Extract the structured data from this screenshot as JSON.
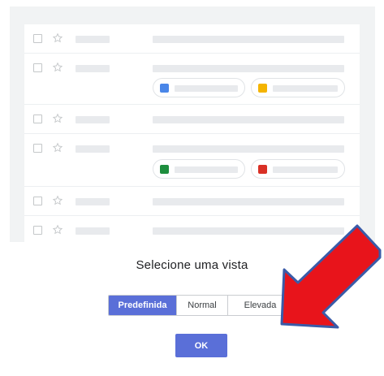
{
  "dialog": {
    "title": "Selecione uma vista",
    "view_options": [
      "Predefinida",
      "Normal",
      "Elevada"
    ],
    "selected_view": "Predefinida",
    "ok_label": "OK"
  },
  "preview": {
    "rows": [
      {
        "type": "plain"
      },
      {
        "type": "attachments",
        "attachments": [
          "docs-icon",
          "slides-icon"
        ]
      },
      {
        "type": "plain"
      },
      {
        "type": "attachments",
        "attachments": [
          "sheets-icon",
          "image-icon"
        ]
      },
      {
        "type": "plain"
      },
      {
        "type": "plain"
      }
    ]
  },
  "colors": {
    "accent": "#5a6fd8",
    "arrow_fill": "#e8141b",
    "arrow_outline": "#3a5ba8",
    "docs": "#4a86e8",
    "slides": "#f4b400",
    "sheets": "#1e8e3e",
    "image": "#d93025"
  }
}
